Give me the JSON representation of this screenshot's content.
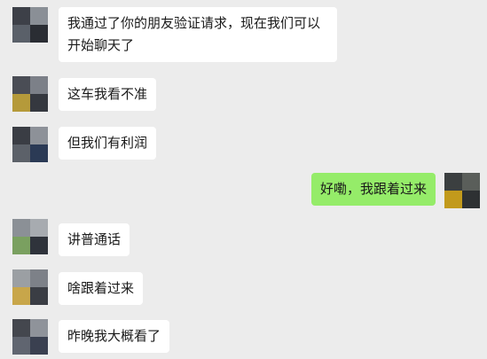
{
  "messages": [
    {
      "text": "我通过了你的朋友验证请求，现在我们可以开始聊天了",
      "sender": "contact"
    },
    {
      "text": "这车我看不准",
      "sender": "contact"
    },
    {
      "text": "但我们有利润",
      "sender": "contact"
    },
    {
      "text": "好嘞，我跟着过来",
      "sender": "self"
    },
    {
      "text": "讲普通话",
      "sender": "contact"
    },
    {
      "text": "啥跟着过来",
      "sender": "contact"
    },
    {
      "text": "昨晚我大概看了",
      "sender": "contact"
    }
  ],
  "colors": {
    "background": "#ececec",
    "contact_bubble": "#ffffff",
    "self_bubble": "#95ec69",
    "text": "#1a1a1a"
  },
  "avatars": {
    "contact": "avatar-contact-pixelated",
    "self": "avatar-self-pixelated"
  }
}
